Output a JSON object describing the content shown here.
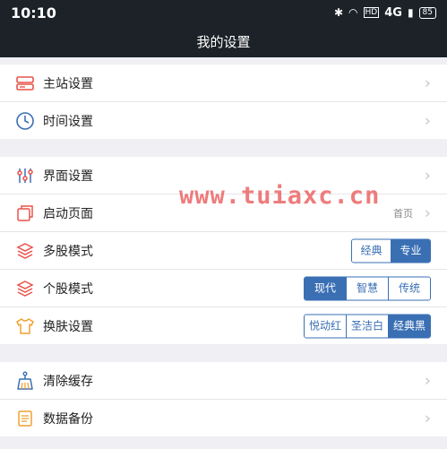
{
  "status_bar": {
    "time": "10:10",
    "network": "4G",
    "battery": "85",
    "hd": "HD"
  },
  "header": {
    "title": "我的设置"
  },
  "groups": [
    {
      "items": [
        {
          "label": "主站设置"
        },
        {
          "label": "时间设置"
        }
      ]
    },
    {
      "items": [
        {
          "label": "界面设置"
        },
        {
          "label": "启动页面",
          "value": "首页"
        },
        {
          "label": "多股模式",
          "options": [
            "经典",
            "专业"
          ],
          "selected": "专业"
        },
        {
          "label": "个股模式",
          "options": [
            "现代",
            "智慧",
            "传统"
          ],
          "selected": "现代"
        },
        {
          "label": "换肤设置",
          "options": [
            "悦动红",
            "圣洁白",
            "经典黑"
          ],
          "selected": "经典黑"
        }
      ]
    },
    {
      "items": [
        {
          "label": "清除缓存"
        },
        {
          "label": "数据备份"
        }
      ]
    }
  ],
  "watermark": "www.tuiaxc.cn",
  "colors": {
    "accent": "#3a6fb4",
    "header_bg": "#1c2228",
    "icon_red": "#e8524a",
    "icon_blue": "#3a6fb4",
    "icon_orange": "#f0a030"
  }
}
